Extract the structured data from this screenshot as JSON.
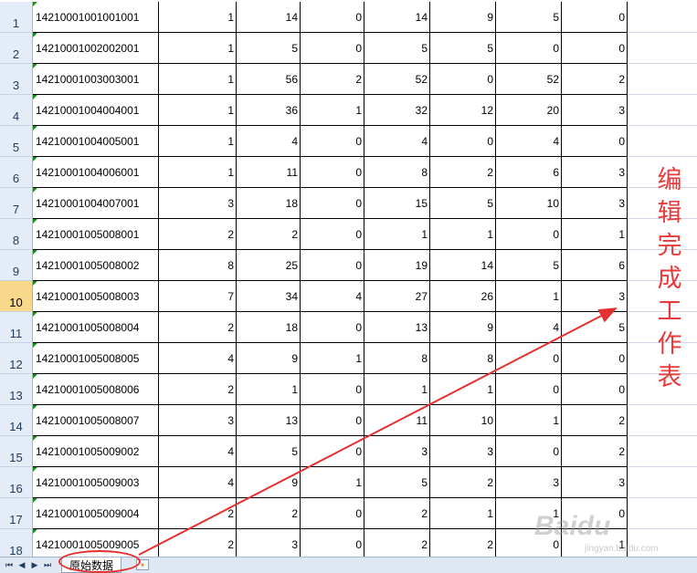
{
  "spreadsheet": {
    "selected_row": "10",
    "rows": [
      {
        "num": "1",
        "id": "14210001001001001",
        "v": [
          "1",
          "14",
          "0",
          "14",
          "9",
          "5",
          "0"
        ]
      },
      {
        "num": "2",
        "id": "14210001002002001",
        "v": [
          "1",
          "5",
          "0",
          "5",
          "5",
          "0",
          "0"
        ]
      },
      {
        "num": "3",
        "id": "14210001003003001",
        "v": [
          "1",
          "56",
          "2",
          "52",
          "0",
          "52",
          "2"
        ]
      },
      {
        "num": "4",
        "id": "14210001004004001",
        "v": [
          "1",
          "36",
          "1",
          "32",
          "12",
          "20",
          "3"
        ]
      },
      {
        "num": "5",
        "id": "14210001004005001",
        "v": [
          "1",
          "4",
          "0",
          "4",
          "0",
          "4",
          "0"
        ]
      },
      {
        "num": "6",
        "id": "14210001004006001",
        "v": [
          "1",
          "11",
          "0",
          "8",
          "2",
          "6",
          "3"
        ]
      },
      {
        "num": "7",
        "id": "14210001004007001",
        "v": [
          "3",
          "18",
          "0",
          "15",
          "5",
          "10",
          "3"
        ]
      },
      {
        "num": "8",
        "id": "14210001005008001",
        "v": [
          "2",
          "2",
          "0",
          "1",
          "1",
          "0",
          "1"
        ]
      },
      {
        "num": "9",
        "id": "14210001005008002",
        "v": [
          "8",
          "25",
          "0",
          "19",
          "14",
          "5",
          "6"
        ]
      },
      {
        "num": "10",
        "id": "14210001005008003",
        "v": [
          "7",
          "34",
          "4",
          "27",
          "26",
          "1",
          "3"
        ]
      },
      {
        "num": "11",
        "id": "14210001005008004",
        "v": [
          "2",
          "18",
          "0",
          "13",
          "9",
          "4",
          "5"
        ]
      },
      {
        "num": "12",
        "id": "14210001005008005",
        "v": [
          "4",
          "9",
          "1",
          "8",
          "8",
          "0",
          "0"
        ]
      },
      {
        "num": "13",
        "id": "14210001005008006",
        "v": [
          "2",
          "1",
          "0",
          "1",
          "1",
          "0",
          "0"
        ]
      },
      {
        "num": "14",
        "id": "14210001005008007",
        "v": [
          "3",
          "13",
          "0",
          "11",
          "10",
          "1",
          "2"
        ]
      },
      {
        "num": "15",
        "id": "14210001005009002",
        "v": [
          "4",
          "5",
          "0",
          "3",
          "3",
          "0",
          "2"
        ]
      },
      {
        "num": "16",
        "id": "14210001005009003",
        "v": [
          "4",
          "9",
          "1",
          "5",
          "2",
          "3",
          "3"
        ]
      },
      {
        "num": "17",
        "id": "14210001005009004",
        "v": [
          "2",
          "2",
          "0",
          "2",
          "1",
          "1",
          "0"
        ]
      },
      {
        "num": "18",
        "id": "14210001005009005",
        "v": [
          "2",
          "3",
          "0",
          "2",
          "2",
          "0",
          "1"
        ]
      }
    ]
  },
  "annotation": {
    "chars": [
      "编",
      "辑",
      "完",
      "成",
      "工",
      "作",
      "表"
    ],
    "color": "#e83a3a"
  },
  "tabs": {
    "nav_first": "⏮",
    "nav_prev": "◀",
    "nav_next": "▶",
    "nav_last": "⏭",
    "sheet_name": "原始数据",
    "add_icon": "new-sheet-icon"
  },
  "watermark": {
    "text": "Baidu",
    "sub": "jingyan.baidu.com"
  }
}
